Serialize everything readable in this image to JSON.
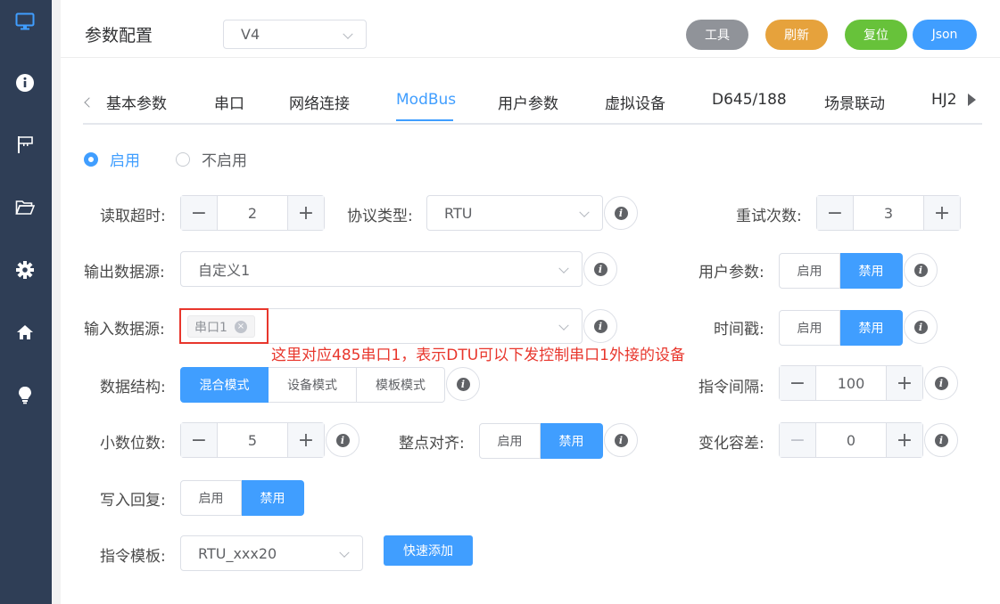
{
  "header": {
    "title": "参数配置",
    "version": "V4",
    "buttons": {
      "tools": "工具",
      "refresh": "刷新",
      "reset": "复位",
      "json": "Json"
    },
    "colors": {
      "tools": "#909399",
      "refresh": "#e6a23c",
      "reset": "#67c23a",
      "json": "#409eff"
    }
  },
  "sidebar": {
    "icons": [
      "monitor-icon",
      "info-icon",
      "flag-icon",
      "folder-icon",
      "gear-icon",
      "home-icon",
      "lightbulb-icon"
    ]
  },
  "tabs": {
    "items": [
      "基本参数",
      "串口",
      "网络连接",
      "ModBus",
      "用户参数",
      "虚拟设备",
      "D645/188",
      "场景联动",
      "HJ2"
    ],
    "active": "ModBus"
  },
  "enable": {
    "on": "启用",
    "off": "不启用",
    "selected": "启用"
  },
  "form": {
    "read_timeout": {
      "label": "读取超时:",
      "value": "2"
    },
    "protocol_type": {
      "label": "协议类型:",
      "value": "RTU"
    },
    "retry_count": {
      "label": "重试次数:",
      "value": "3"
    },
    "output_source": {
      "label": "输出数据源:",
      "value": "自定义1"
    },
    "user_params": {
      "label": "用户参数:",
      "on": "启用",
      "off": "禁用",
      "selected": "禁用"
    },
    "input_source": {
      "label": "输入数据源:",
      "tag": "串口1"
    },
    "timestamp": {
      "label": "时间戳:",
      "on": "启用",
      "off": "禁用",
      "selected": "禁用"
    },
    "data_structure": {
      "label": "数据结构:",
      "options": [
        "混合模式",
        "设备模式",
        "模板模式"
      ],
      "selected": "混合模式"
    },
    "cmd_interval": {
      "label": "指令间隔:",
      "value": "100"
    },
    "decimals": {
      "label": "小数位数:",
      "value": "5"
    },
    "align_hour": {
      "label": "整点对齐:",
      "on": "启用",
      "off": "禁用",
      "selected": "禁用"
    },
    "change_tolerance": {
      "label": "变化容差:",
      "value": "0"
    },
    "write_reply": {
      "label": "写入回复:",
      "on": "启用",
      "off": "禁用",
      "selected": "禁用"
    },
    "cmd_template": {
      "label": "指令模板:",
      "value": "RTU_xxx20",
      "quick_add": "快速添加"
    }
  },
  "annotation": "这里对应485串口1，表示DTU可以下发控制串口1外接的设备"
}
